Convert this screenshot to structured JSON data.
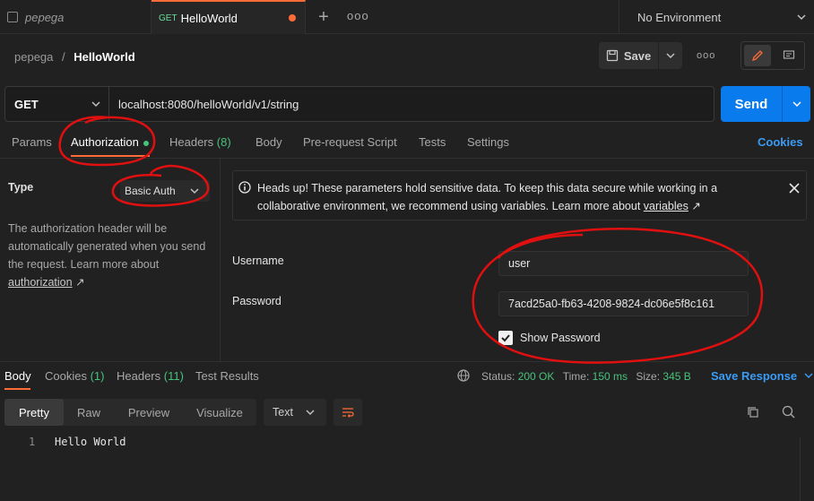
{
  "tabs": [
    {
      "name": "pepega"
    },
    {
      "method": "GET",
      "name": "HelloWorld"
    }
  ],
  "environment": "No Environment",
  "breadcrumb": {
    "workspace": "pepega",
    "separator": "/",
    "request": "HelloWorld"
  },
  "toolbar": {
    "save_label": "Save",
    "more": "ooo"
  },
  "request": {
    "method": "GET",
    "url": "localhost:8080/helloWorld/v1/string",
    "send_label": "Send"
  },
  "request_tabs": {
    "params": "Params",
    "authorization": "Authorization",
    "headers": "Headers",
    "headers_count": "(8)",
    "body": "Body",
    "prerequest": "Pre-request Script",
    "tests": "Tests",
    "settings": "Settings",
    "cookies": "Cookies"
  },
  "auth": {
    "type_label": "Type",
    "type_value": "Basic Auth",
    "description": "The authorization header will be automatically generated when you send the request. Learn more about",
    "description_link": "authorization",
    "notice": "Heads up! These parameters hold sensitive data. To keep this data secure while working in a collaborative environment, we recommend using variables. Learn more about",
    "notice_link": "variables",
    "username_label": "Username",
    "username_value": "user",
    "password_label": "Password",
    "password_value": "7acd25a0-fb63-4208-9824-dc06e5f8c161",
    "show_password_label": "Show Password",
    "show_password_checked": true
  },
  "response": {
    "tabs": {
      "body": "Body",
      "cookies": "Cookies",
      "cookies_count": "(1)",
      "headers": "Headers",
      "headers_count": "(11)",
      "test_results": "Test Results"
    },
    "status_label": "Status:",
    "status_value": "200 OK",
    "time_label": "Time:",
    "time_value": "150 ms",
    "size_label": "Size:",
    "size_value": "345 B",
    "save_label": "Save Response",
    "view_tabs": [
      "Pretty",
      "Raw",
      "Preview",
      "Visualize"
    ],
    "format": "Text",
    "lines": [
      {
        "num": "1",
        "text": "Hello World"
      }
    ]
  },
  "colors": {
    "accent": "#ff6c37",
    "send": "#097bed",
    "link": "#3b9bf4",
    "success": "#49c27c",
    "annotation": "#e01010"
  }
}
